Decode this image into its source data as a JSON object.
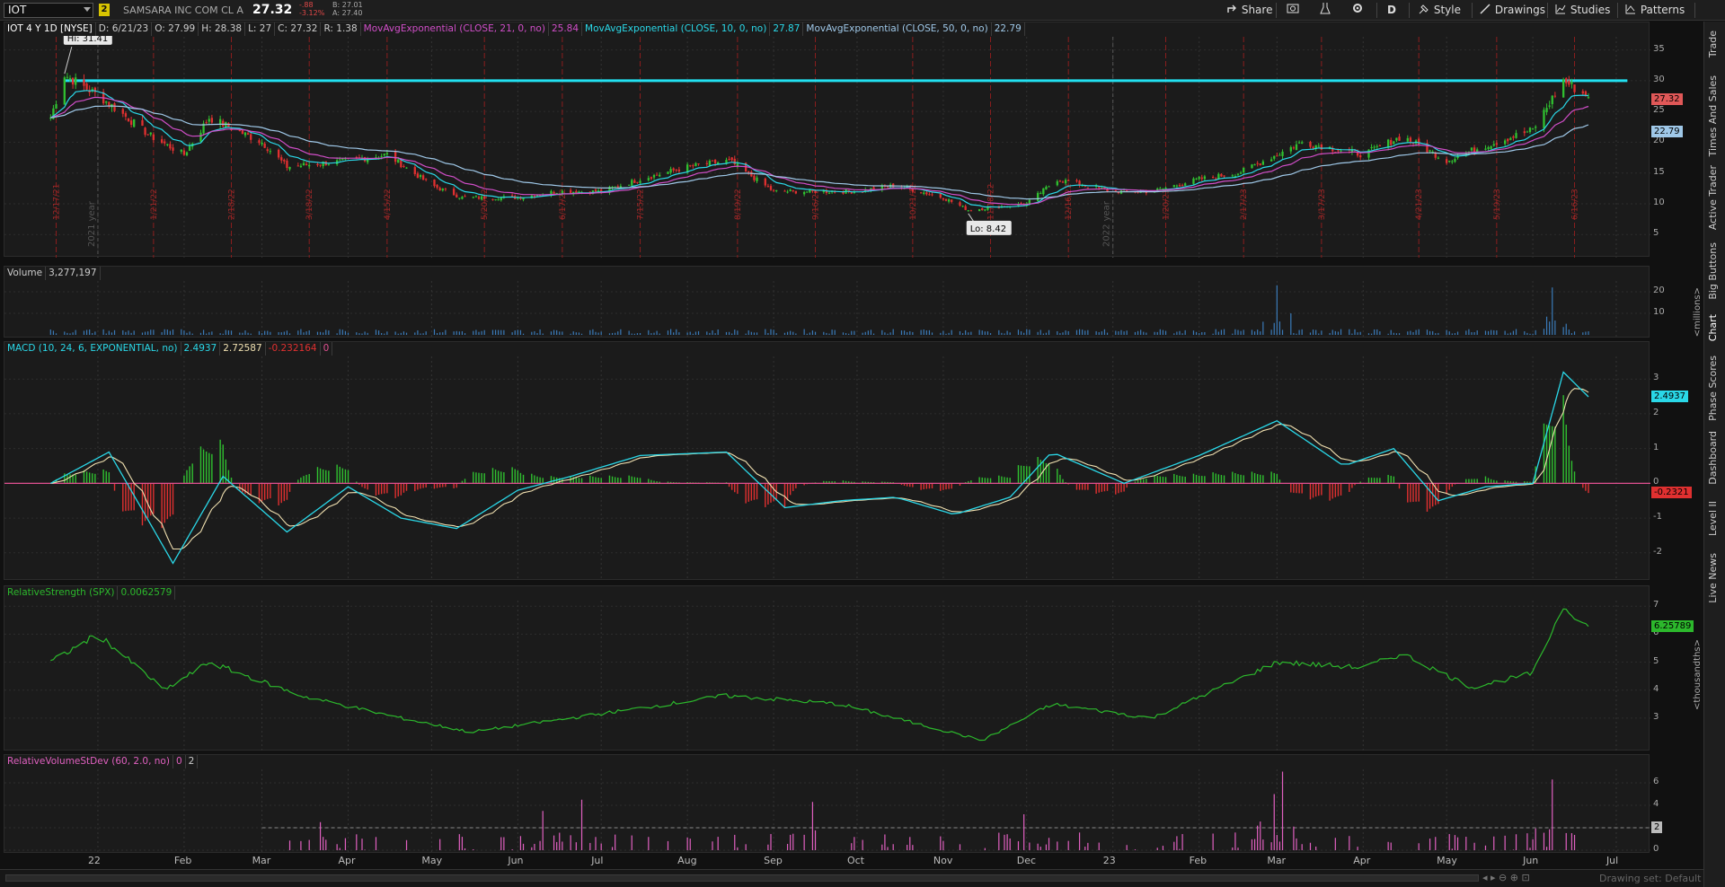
{
  "toolbar": {
    "symbol": "IOT",
    "link_number": "2",
    "company": "SAMSARA INC COM CL A",
    "last": "27.32",
    "change": "-.88",
    "change_pct": "-3.12%",
    "bid": "B: 27.01",
    "ask": "A: 27.40",
    "share": "Share",
    "period": "D",
    "style": "Style",
    "drawings": "Drawings",
    "studies": "Studies",
    "patterns": "Patterns"
  },
  "price_panel": {
    "title": "IOT 4 Y 1D [NYSE]",
    "date": "D: 6/21/23",
    "open": "O: 27.99",
    "high": "H: 28.38",
    "low": "L: 27",
    "close": "C: 27.32",
    "range": "R: 1.38",
    "ema21_label": "MovAvgExponential (CLOSE, 21, 0, no)",
    "ema21_value": "25.84",
    "ema10_label": "MovAvgExponential (CLOSE, 10, 0, no)",
    "ema10_value": "27.87",
    "ema50_label": "MovAvgExponential (CLOSE, 50, 0, no)",
    "ema50_value": "22.79",
    "hi_label": "Hi: 31.41",
    "lo_label": "Lo: 8.42",
    "year_2021": "2021 year",
    "year_2022": "2022 year",
    "y_ticks": [
      "35",
      "30",
      "25",
      "20",
      "15",
      "10",
      "5"
    ],
    "tag_last": "27.32",
    "tag_ema50": "22.79",
    "event_labels": [
      "12/17/21",
      "1/21/22",
      "2/18/22",
      "3/18/22",
      "4/15/22",
      "5/20/22",
      "6/17/22",
      "7/15/22",
      "8/19/22",
      "9/16/22",
      "10/21/22",
      "11/18/22",
      "12/16/22",
      "1/20/23",
      "2/17/23",
      "3/17/23",
      "4/21/23",
      "5/19/23",
      "6/16/23"
    ]
  },
  "volume_panel": {
    "title": "Volume",
    "value": "3,277,197",
    "y_ticks": [
      "20",
      "10"
    ],
    "unit": "<millions>"
  },
  "macd_panel": {
    "title": "MACD (10, 24, 6, EXPONENTIAL, no)",
    "value": "2.4937",
    "avg": "2.72587",
    "diff": "-0.232164",
    "zero": "0",
    "y_ticks": [
      "3",
      "2",
      "1",
      "0",
      "-1",
      "-2"
    ],
    "tag_value": "2.4937",
    "tag_diff": "-0.2321"
  },
  "rs_panel": {
    "title": "RelativeStrength (SPX)",
    "value": "0.0062579",
    "y_ticks": [
      "7",
      "6",
      "5",
      "4",
      "3"
    ],
    "tag": "6.25789",
    "unit": "<thousandths>"
  },
  "rvol_panel": {
    "title": "RelativeVolumeStDev (60, 2.0, no)",
    "v1": "0",
    "v2": "2",
    "y_ticks": [
      "6",
      "4",
      "2",
      "0"
    ],
    "tag": "2"
  },
  "x_axis": [
    "22",
    "Feb",
    "Mar",
    "Apr",
    "May",
    "Jun",
    "Jul",
    "Aug",
    "Sep",
    "Oct",
    "Nov",
    "Dec",
    "23",
    "Feb",
    "Mar",
    "Apr",
    "May",
    "Jun",
    "Jul"
  ],
  "right_tabs": [
    "Trade",
    "Times And Sales",
    "Active Trader",
    "Big Buttons",
    "Chart",
    "Phase Scores",
    "Dashboard",
    "Level II",
    "Live News"
  ],
  "footer": {
    "drawing_set": "Drawing set: Default"
  },
  "colors": {
    "ema10": "#2ad8e8",
    "ema21": "#d04ec8",
    "ema50": "#9fc8e8",
    "resistance": "#22e0f0",
    "up": "#30c030",
    "down": "#e03030",
    "rs": "#2cb82c",
    "rvol": "#e060c0",
    "volume": "#3a7ab8"
  },
  "chart_data": [
    {
      "type": "candlestick",
      "title": "IOT 4 Y 1D [NYSE]",
      "x": [
        "2021-12-15",
        "2021-12-20",
        "2022-01-03",
        "2022-01-20",
        "2022-02-01",
        "2022-02-10",
        "2022-03-01",
        "2022-03-10",
        "2022-04-01",
        "2022-04-15",
        "2022-05-01",
        "2022-05-12",
        "2022-06-01",
        "2022-06-15",
        "2022-07-01",
        "2022-07-15",
        "2022-08-01",
        "2022-08-16",
        "2022-09-01",
        "2022-09-15",
        "2022-10-01",
        "2022-10-15",
        "2022-11-01",
        "2022-11-10",
        "2022-12-01",
        "2022-12-12",
        "2023-01-01",
        "2023-01-15",
        "2023-02-01",
        "2023-02-15",
        "2023-03-01",
        "2023-03-10",
        "2023-04-01",
        "2023-04-15",
        "2023-05-01",
        "2023-05-12",
        "2023-06-01",
        "2023-06-12",
        "2023-06-21"
      ],
      "close": [
        24,
        31,
        27,
        21,
        18,
        24,
        20,
        16,
        17,
        18,
        13,
        11,
        11,
        12,
        12,
        14,
        16,
        17,
        12,
        12,
        12,
        13,
        11,
        9,
        10,
        14,
        12,
        12,
        14,
        15,
        18,
        20,
        18,
        21,
        17,
        19,
        22,
        30,
        27.32
      ],
      "ema10_last": 27.87,
      "ema21_last": 25.84,
      "ema50_last": 22.79,
      "resistance": 30,
      "high": 31.41,
      "low": 8.42,
      "ylim": [
        3,
        38
      ]
    },
    {
      "type": "bar",
      "title": "Volume",
      "last": 3277197,
      "spikes": [
        [
          "2023-03-01",
          23
        ],
        [
          "2023-06-08",
          22
        ]
      ],
      "ylim": [
        0,
        25
      ]
    },
    {
      "type": "line",
      "title": "MACD (10, 24, 6, EXPONENTIAL, no)",
      "x": [
        "2021-12-15",
        "2022-01-05",
        "2022-01-28",
        "2022-02-15",
        "2022-03-10",
        "2022-04-01",
        "2022-04-20",
        "2022-05-10",
        "2022-06-01",
        "2022-06-20",
        "2022-07-15",
        "2022-08-15",
        "2022-09-05",
        "2022-09-25",
        "2022-10-15",
        "2022-11-05",
        "2022-11-25",
        "2022-12-10",
        "2023-01-05",
        "2023-02-01",
        "2023-03-01",
        "2023-03-25",
        "2023-04-12",
        "2023-04-28",
        "2023-05-15",
        "2023-06-01",
        "2023-06-12",
        "2023-06-21"
      ],
      "macd": [
        0,
        0.9,
        -2.3,
        0.2,
        -1.4,
        -0.1,
        -1,
        -1.3,
        -0.2,
        0.2,
        0.8,
        0.9,
        -0.7,
        -0.5,
        -0.4,
        -0.9,
        -0.4,
        0.9,
        0,
        0.8,
        1.8,
        0.5,
        1,
        -0.5,
        -0.1,
        0,
        3.2,
        2.49
      ],
      "avg_last": 2.72587,
      "diff_last": -0.232164,
      "ylim": [
        -2.6,
        3.6
      ]
    },
    {
      "type": "line",
      "title": "RelativeStrength (SPX)",
      "x": [
        "2021-12-15",
        "2022-01-01",
        "2022-01-25",
        "2022-02-10",
        "2022-03-15",
        "2022-04-20",
        "2022-05-15",
        "2022-06-20",
        "2022-08-15",
        "2022-09-25",
        "2022-11-15",
        "2022-12-10",
        "2023-01-15",
        "2023-03-01",
        "2023-04-01",
        "2023-04-15",
        "2023-05-10",
        "2023-06-01",
        "2023-06-12",
        "2023-06-21"
      ],
      "values": [
        5,
        6,
        4,
        5,
        3.8,
        3,
        2.5,
        3,
        3.8,
        3.5,
        2.2,
        3.5,
        3,
        5,
        4.8,
        5.3,
        4.1,
        4.6,
        7,
        6.26
      ],
      "ylim": [
        2,
        7.2
      ]
    },
    {
      "type": "bar",
      "title": "RelativeVolumeStDev (60, 2.0, no)",
      "threshold": 2,
      "spikes": [
        [
          "2022-03-22",
          2.5
        ],
        [
          "2022-06-10",
          3.5
        ],
        [
          "2022-06-24",
          4.5
        ],
        [
          "2022-09-15",
          4.3
        ],
        [
          "2022-11-30",
          3.2
        ],
        [
          "2023-02-28",
          5
        ],
        [
          "2023-03-03",
          7
        ],
        [
          "2023-06-08",
          6.3
        ]
      ],
      "ylim": [
        0,
        7.2
      ]
    }
  ]
}
